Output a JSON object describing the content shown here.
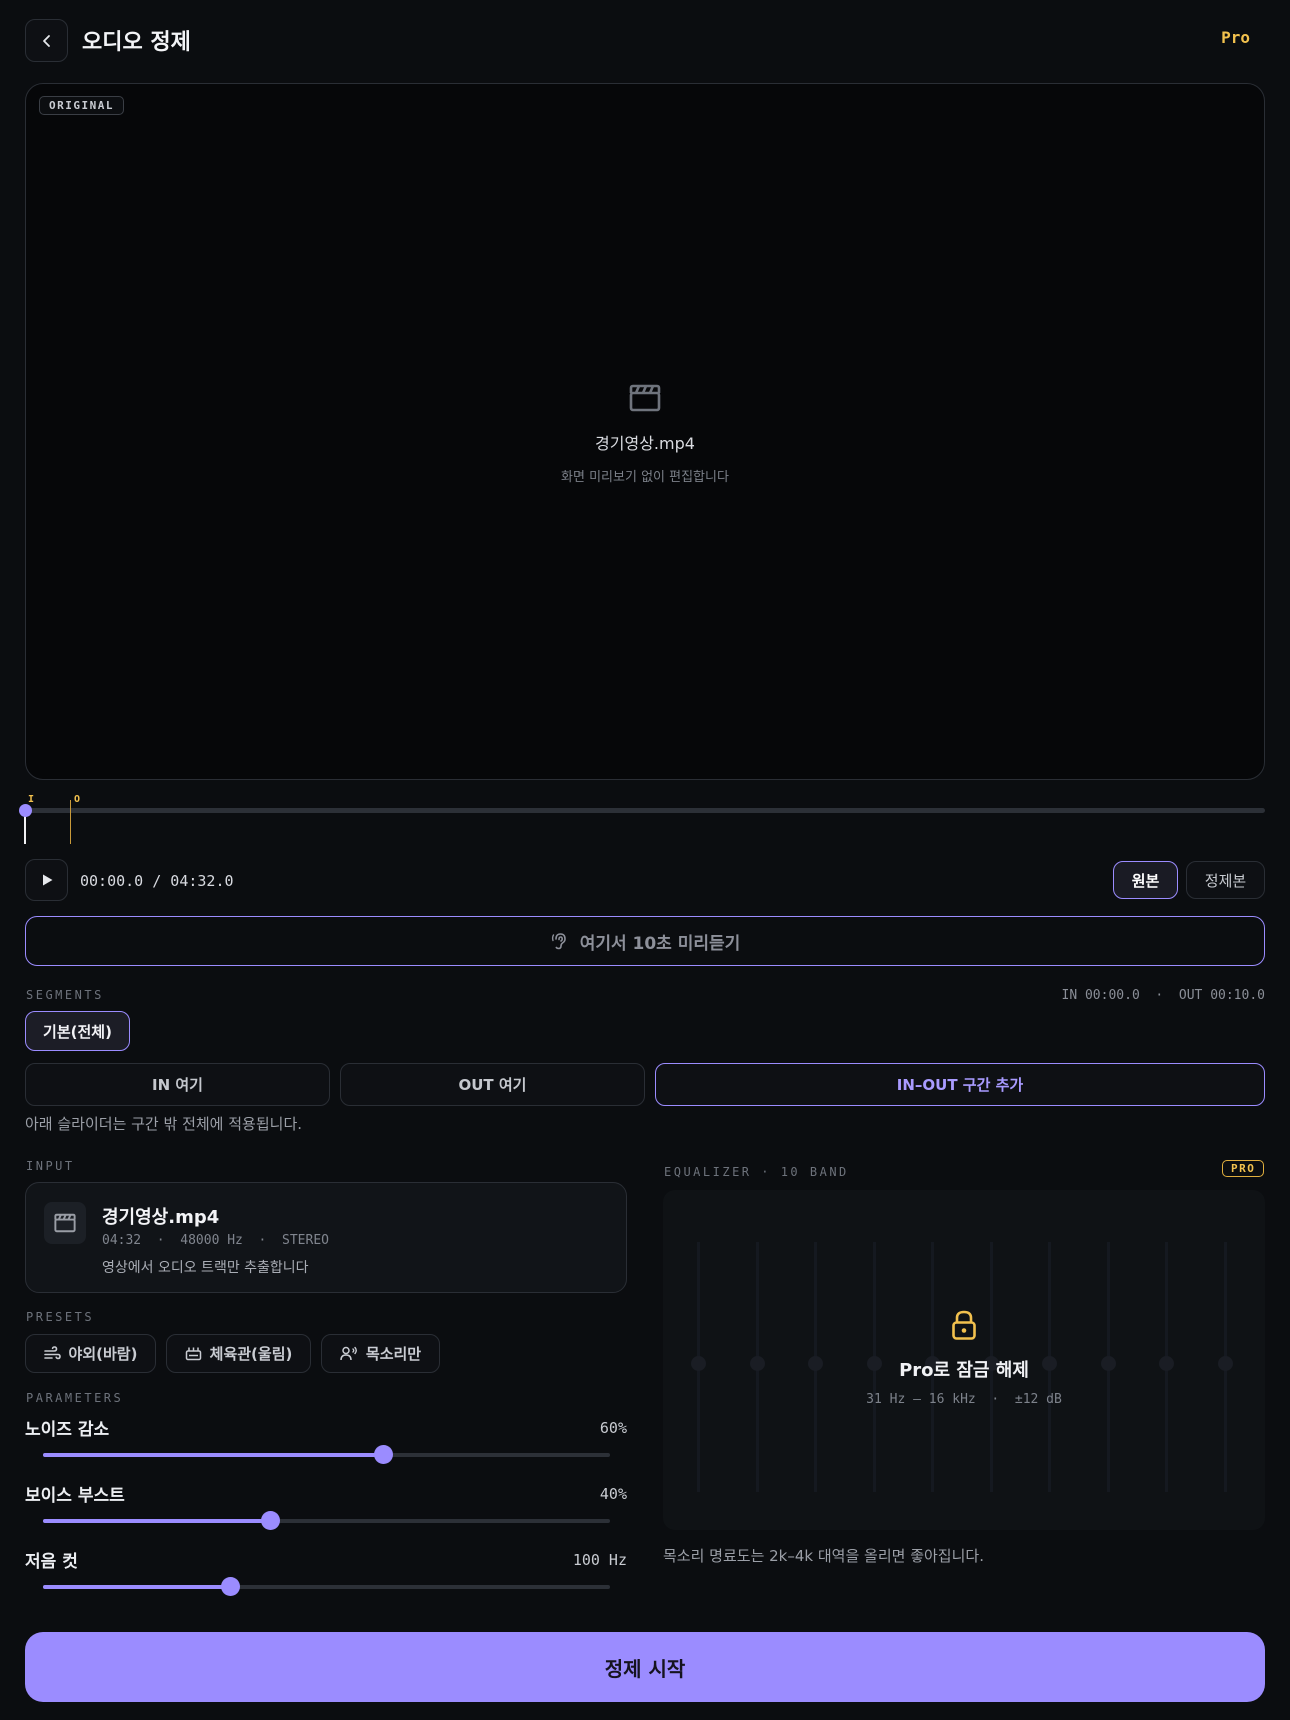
{
  "header": {
    "title": "오디오 정제",
    "pro_label": "Pro"
  },
  "preview": {
    "badge": "ORIGINAL",
    "filename": "경기영상.mp4",
    "subtitle": "화면 미리보기 없이 편집합니다"
  },
  "timeline": {
    "in_marker": "I",
    "out_marker": "O",
    "position": 0.0
  },
  "playback": {
    "timecode": "00:00.0 / 04:32.0",
    "original_label": "원본",
    "cleaned_label": "정제본",
    "preview10_label": "여기서 10초 미리듣기"
  },
  "segments": {
    "section_label": "SEGMENTS",
    "readout": "IN 00:00.0  ·  OUT 00:10.0",
    "chip_label": "기본(전체)",
    "in_here": "IN 여기",
    "out_here": "OUT 여기",
    "add_range": "IN–OUT 구간 추가",
    "note": "아래 슬라이더는 구간 밖 전체에 적용됩니다."
  },
  "input": {
    "section_label": "INPUT",
    "filename": "경기영상.mp4",
    "meta": "04:32  ·  48000 Hz  ·  STEREO",
    "description": "영상에서 오디오 트랙만 추출합니다"
  },
  "presets": {
    "section_label": "PRESETS",
    "items": [
      {
        "label": "야외(바람)",
        "icon": "wind-icon"
      },
      {
        "label": "체육관(울림)",
        "icon": "stadium-icon"
      },
      {
        "label": "목소리만",
        "icon": "voice-icon"
      }
    ]
  },
  "parameters": {
    "section_label": "PARAMETERS",
    "noise_reduction": {
      "name": "노이즈 감소",
      "value_text": "60%",
      "level": 0.6
    },
    "voice_boost": {
      "name": "보이스 부스트",
      "value_text": "40%",
      "level": 0.4
    },
    "low_cut": {
      "name": "저음 컷",
      "value_text": "100 Hz",
      "level": 0.33
    }
  },
  "equalizer": {
    "section_label": "EQUALIZER · 10 BAND",
    "pro_badge": "PRO",
    "lock_title": "Pro로 잠금 해제",
    "lock_sub": "31 Hz – 16 kHz  ·  ±12 dB",
    "note": "목소리 명료도는 2k–4k 대역을 올리면 좋아집니다.",
    "band_count": 10
  },
  "actions": {
    "start_label": "정제 시작"
  },
  "colors": {
    "accent": "#9b8cff",
    "pro": "#f2c14e",
    "background": "#0b0d10"
  }
}
